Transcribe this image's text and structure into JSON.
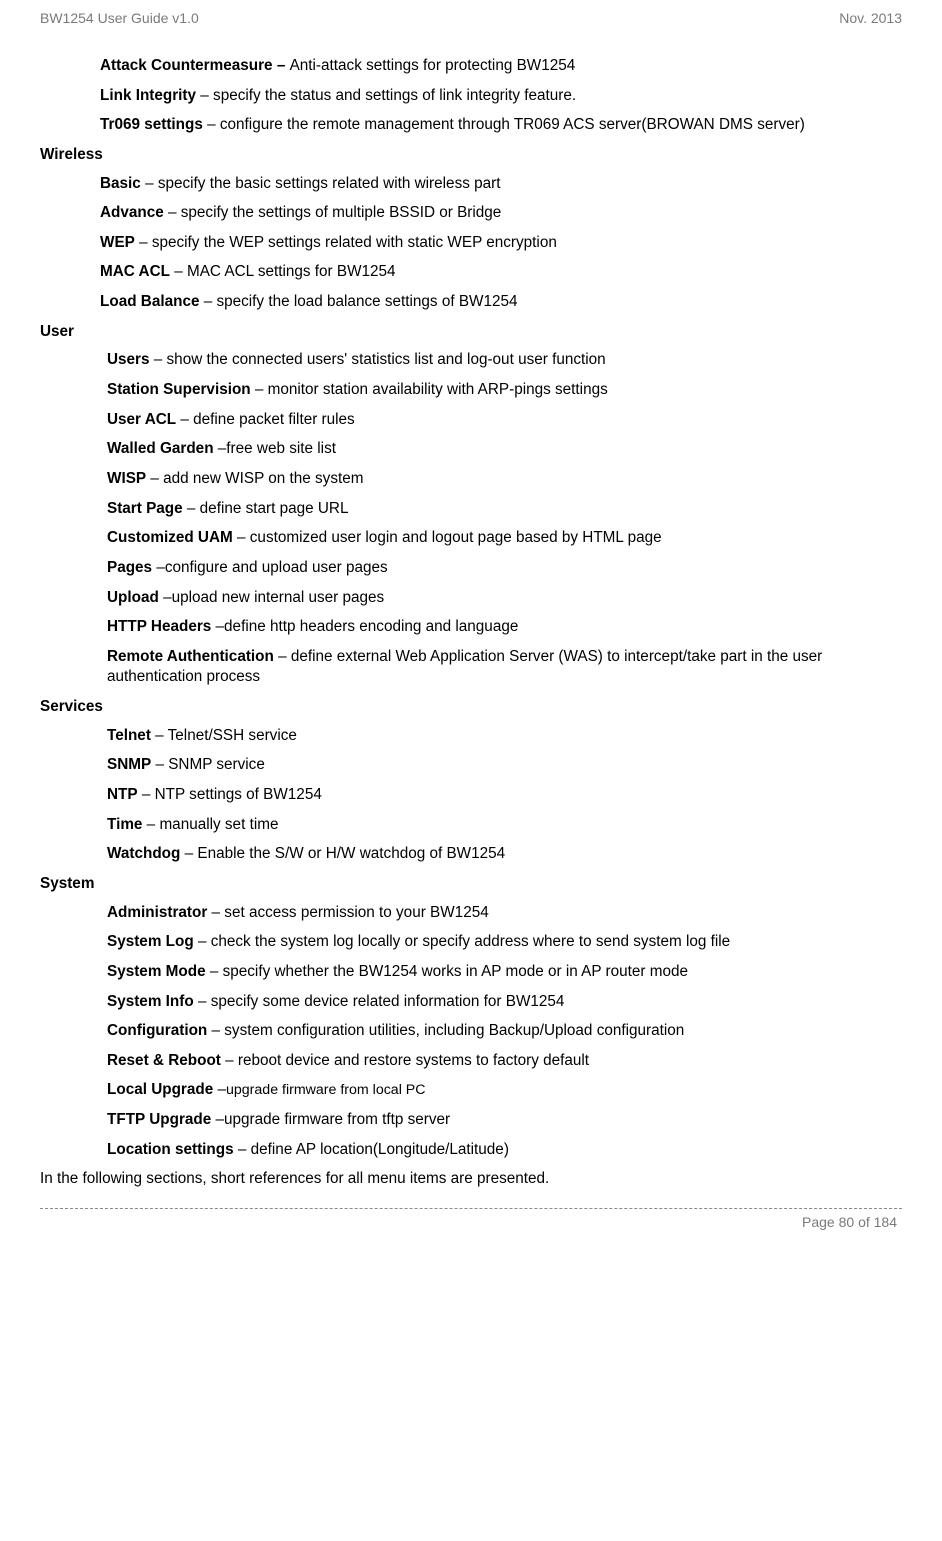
{
  "header": {
    "left": "BW1254 User Guide v1.0",
    "right": "Nov.  2013"
  },
  "intro_items": [
    {
      "bold": "Attack Countermeasure – ",
      "rest": "Anti-attack settings for protecting BW1254"
    },
    {
      "bold": "Link Integrity",
      "rest": " – specify the status and settings of link integrity feature."
    },
    {
      "bold": "Tr069 settings",
      "rest": " – configure the remote management through TR069 ACS server(BROWAN DMS server)"
    }
  ],
  "sections": [
    {
      "title": "Wireless",
      "items": [
        {
          "bold": "Basic",
          "rest": " – specify the basic settings related with wireless part"
        },
        {
          "bold": "Advance",
          "rest": " – specify the settings of multiple BSSID or Bridge"
        },
        {
          "bold": "WEP",
          "rest": " – specify the WEP settings related with static WEP encryption"
        },
        {
          "bold": "MAC ACL",
          "rest": " – MAC ACL settings for BW1254"
        },
        {
          "bold": "Load Balance",
          "rest": " – specify the load balance settings of BW1254"
        }
      ]
    },
    {
      "title": "User",
      "indent": true,
      "items": [
        {
          "bold": "Users",
          "rest": " – show the connected users' statistics list and log-out user function"
        },
        {
          "bold": "Station Supervision",
          "rest": " – monitor station availability with ARP-pings settings"
        },
        {
          "bold": "User ACL",
          "rest": " – define packet filter rules"
        },
        {
          "bold": "Walled Garden",
          "rest": " –free web site list"
        },
        {
          "bold": "WISP",
          "rest": " – add new WISP on the system"
        },
        {
          "bold": "Start Page",
          "rest": " – define start page URL"
        },
        {
          "bold": "Customized UAM",
          "rest": " – customized user login and logout page based by HTML page"
        },
        {
          "bold": "Pages",
          "rest": " –configure and upload user pages"
        },
        {
          "bold": "Upload",
          "rest": " –upload new internal user pages"
        },
        {
          "bold": "HTTP Headers",
          "rest": " –define http headers encoding and language"
        },
        {
          "bold": "Remote Authentication",
          "rest": " – define external Web Application Server (WAS) to intercept/take part in the user authentication process"
        }
      ]
    },
    {
      "title": "Services",
      "indent": true,
      "items": [
        {
          "bold": "Telnet",
          "rest": " – Telnet/SSH service"
        },
        {
          "bold": "SNMP",
          "rest": " – SNMP service"
        },
        {
          "bold": "NTP",
          "rest": " – NTP settings of BW1254"
        },
        {
          "bold": "Time",
          "rest": " – manually set time"
        },
        {
          "bold": "Watchdog",
          "rest": " – Enable the S/W or H/W watchdog of BW1254"
        }
      ]
    },
    {
      "title": "System",
      "indent": true,
      "items": [
        {
          "bold": "Administrator",
          "rest": " – set access permission to your BW1254"
        },
        {
          "bold": "System Log",
          "rest": " – check the system log locally or specify address where to send system log file"
        },
        {
          "bold": "System Mode",
          "rest": " – specify whether the BW1254 works in AP mode or in AP router mode"
        },
        {
          "bold": "System Info",
          "rest": " – specify some device related information for BW1254"
        },
        {
          "bold": "Configuration",
          "rest": " – system configuration utilities, including Backup/Upload configuration"
        },
        {
          "bold": "Reset & Reboot",
          "rest": " – reboot device and restore systems to factory default"
        },
        {
          "bold": "Local Upgrade",
          "rest": " –",
          "small_rest": "upgrade firmware from local PC"
        },
        {
          "bold": "TFTP Upgrade",
          "rest": " –upgrade firmware from tftp server"
        },
        {
          "bold": "Location settings",
          "rest": " – define AP location(Longitude/Latitude)"
        }
      ]
    }
  ],
  "closing": "In the following sections, short references for all menu items are presented.",
  "footer": "Page 80 of 184"
}
